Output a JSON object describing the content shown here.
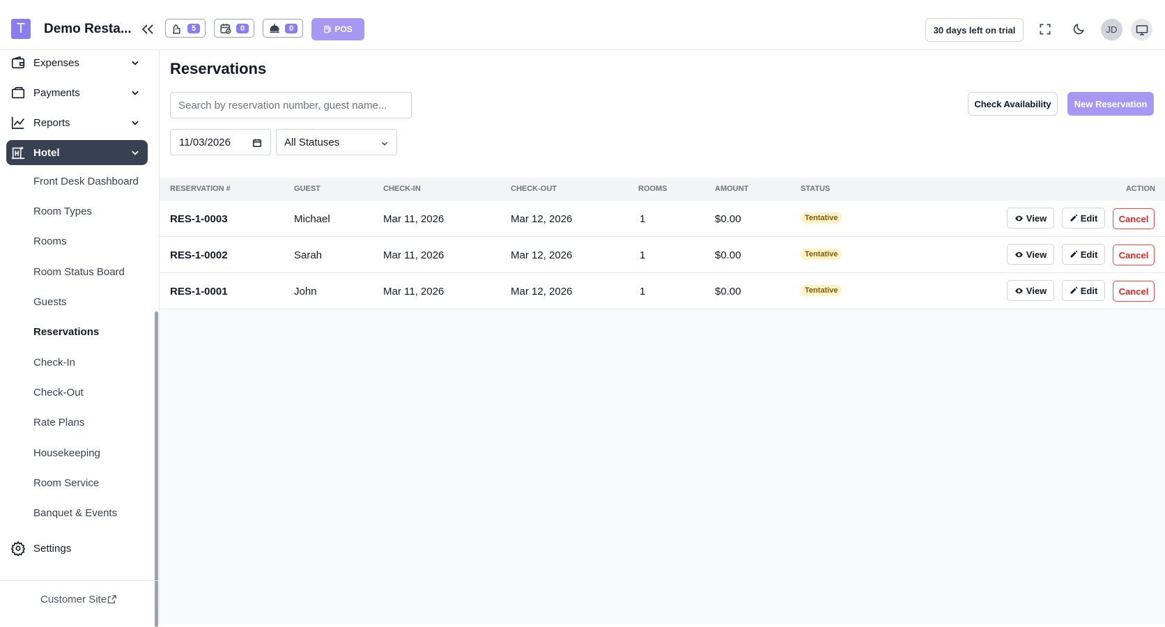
{
  "header": {
    "logo_letter": "T",
    "brand": "Demo Resta...",
    "chips": [
      {
        "icon": "waiter-icon",
        "count": "5"
      },
      {
        "icon": "calendar-check-icon",
        "count": "0"
      },
      {
        "icon": "food-cover-icon",
        "count": "0"
      }
    ],
    "pos_label": "POS",
    "trial": "30 days left on trial",
    "avatar": "JD"
  },
  "sidebar": {
    "main_items": [
      {
        "label": "Expenses",
        "icon": "wallet-icon"
      },
      {
        "label": "Payments",
        "icon": "payments-icon"
      },
      {
        "label": "Reports",
        "icon": "chart-line-icon"
      },
      {
        "label": "Hotel",
        "icon": "hotel-icon"
      }
    ],
    "sub_items": [
      "Front Desk Dashboard",
      "Room Types",
      "Rooms",
      "Room Status Board",
      "Guests",
      "Reservations",
      "Check-In",
      "Check-Out",
      "Rate Plans",
      "Housekeeping",
      "Room Service",
      "Banquet & Events"
    ],
    "settings": "Settings",
    "customer_site": "Customer Site"
  },
  "main": {
    "title": "Reservations",
    "search_placeholder": "Search by reservation number, guest name...",
    "check_availability": "Check Availability",
    "new_reservation": "New Reservation",
    "date_value": "11/03/2026",
    "status_filter": "All Statuses",
    "columns": [
      "RESERVATION #",
      "GUEST",
      "CHECK-IN",
      "CHECK-OUT",
      "ROOMS",
      "AMOUNT",
      "STATUS",
      "ACTION"
    ],
    "rows": [
      {
        "number": "RES-1-0003",
        "guest": "Michael",
        "check_in": "Mar 11, 2026",
        "check_out": "Mar 12, 2026",
        "rooms": "1",
        "amount": "$0.00",
        "status": "Tentative"
      },
      {
        "number": "RES-1-0002",
        "guest": "Sarah",
        "check_in": "Mar 11, 2026",
        "check_out": "Mar 12, 2026",
        "rooms": "1",
        "amount": "$0.00",
        "status": "Tentative"
      },
      {
        "number": "RES-1-0001",
        "guest": "John",
        "check_in": "Mar 11, 2026",
        "check_out": "Mar 12, 2026",
        "rooms": "1",
        "amount": "$0.00",
        "status": "Tentative"
      }
    ],
    "actions": {
      "view": "View",
      "edit": "Edit",
      "cancel": "Cancel"
    }
  }
}
